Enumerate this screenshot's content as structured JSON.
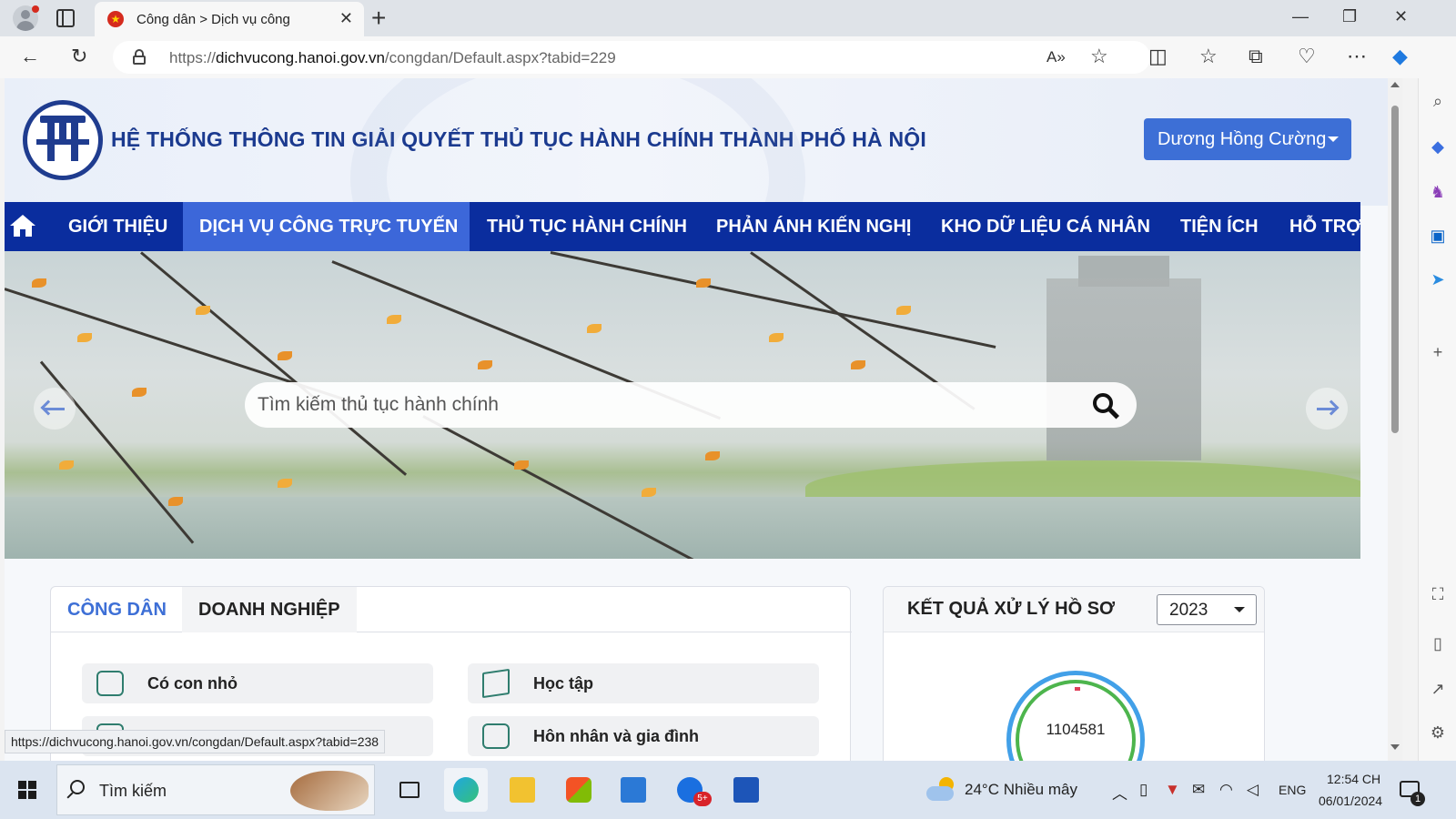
{
  "browser": {
    "tab_title": "Công dân > Dịch vụ công",
    "url_prefix": "https://",
    "url_domain": "dichvucong.hanoi.gov.vn",
    "url_path": "/congdan/Default.aspx?tabid=229",
    "status_url": "https://dichvucong.hanoi.gov.vn/congdan/Default.aspx?tabid=238"
  },
  "site": {
    "title": "HỆ THỐNG THÔNG TIN GIẢI QUYẾT THỦ TỤC HÀNH CHÍNH THÀNH PHỐ HÀ NỘI",
    "user_name": "Dương Hồng Cường"
  },
  "nav": {
    "items": [
      "GIỚI THIỆU",
      "DỊCH VỤ CÔNG TRỰC TUYẾN",
      "THỦ TỤC HÀNH CHÍNH",
      "PHẢN ÁNH KIẾN NGHỊ",
      "KHO DỮ LIỆU CÁ NHÂN",
      "TIỆN ÍCH",
      "HỖ TRỢ"
    ],
    "active_index": 1
  },
  "search": {
    "placeholder": "Tìm kiếm thủ tục hành chính"
  },
  "services_panel": {
    "tabs": [
      "CÔNG DÂN",
      "DOANH NGHIỆP"
    ],
    "items": [
      "Có con nhỏ",
      "Học tập",
      "Hôn nhân và gia đình"
    ]
  },
  "results_panel": {
    "title": "KẾT QUẢ XỬ LÝ HỒ SƠ",
    "year": "2023",
    "total": "1104581"
  },
  "taskbar": {
    "search_text": "Tìm kiếm",
    "weather": "24°C  Nhiều mây",
    "language": "ENG",
    "time": "12:54 CH",
    "date": "06/01/2024",
    "zalo_badge": "5+",
    "notification_count": "1"
  },
  "colors": {
    "nav_bg": "#0a2d9e",
    "nav_active": "#3c67d9",
    "title_blue": "#1b3a8f",
    "user_button": "#3d6fd6"
  }
}
